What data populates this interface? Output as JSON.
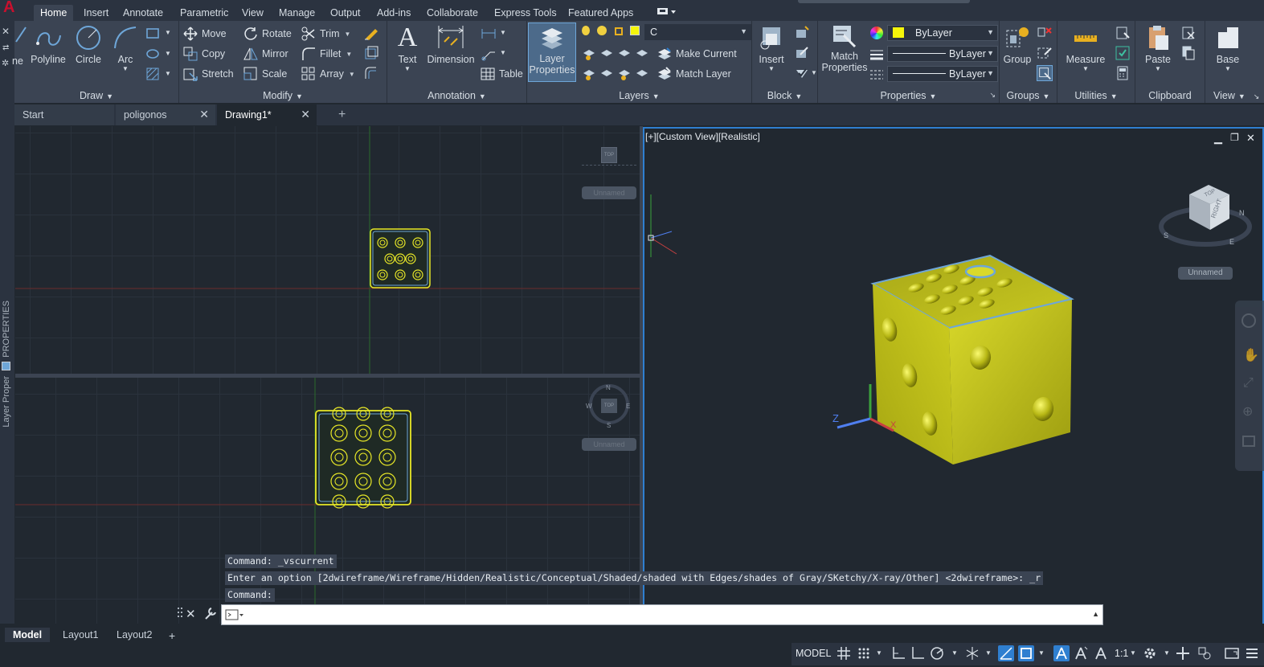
{
  "menubar": {
    "tabs": [
      "Home",
      "Insert",
      "Annotate",
      "Parametric",
      "View",
      "Manage",
      "Output",
      "Add-ins",
      "Collaborate",
      "Express Tools",
      "Featured Apps"
    ],
    "active": "Home"
  },
  "ribbon": {
    "draw": {
      "title": "Draw",
      "line_partial": "ne",
      "polyline": "Polyline",
      "circle": "Circle",
      "arc": "Arc"
    },
    "modify": {
      "title": "Modify",
      "move": "Move",
      "rotate": "Rotate",
      "trim": "Trim",
      "copy": "Copy",
      "mirror": "Mirror",
      "fillet": "Fillet",
      "stretch": "Stretch",
      "scale": "Scale",
      "array": "Array"
    },
    "annotation": {
      "title": "Annotation",
      "text": "Text",
      "dimension": "Dimension",
      "table": "Table"
    },
    "layers": {
      "title": "Layers",
      "layer_properties_line1": "Layer",
      "layer_properties_line2": "Properties",
      "current_layer": "C",
      "make_current": "Make Current",
      "match_layer": "Match Layer"
    },
    "block": {
      "title": "Block",
      "insert": "Insert"
    },
    "properties": {
      "title": "Properties",
      "match_line1": "Match",
      "match_line2": "Properties",
      "color": "ByLayer",
      "linetype": "ByLayer",
      "lineweight": "ByLayer"
    },
    "groups": {
      "title": "Groups",
      "group": "Group"
    },
    "utilities": {
      "title": "Utilities",
      "measure": "Measure"
    },
    "clipboard": {
      "title": "Clipboard",
      "paste": "Paste"
    },
    "view": {
      "title": "View",
      "base": "Base"
    }
  },
  "doctabs": {
    "tabs": [
      "Start",
      "poligonos",
      "Drawing1*"
    ],
    "active": "Drawing1*"
  },
  "leftstrip": {
    "properties": "PROPERTIES",
    "layer_properties": "Layer Proper"
  },
  "viewport3d": {
    "label": "[+][Custom View][Realistic]",
    "viewcube_top": "TOP",
    "viewcube_right": "RIGHT",
    "compass_n": "N",
    "compass_s": "S",
    "compass_e": "E",
    "ucs_name": "Unnamed"
  },
  "viewport_top": {
    "ucs_name": "Unnamed",
    "cube_face": "TOP"
  },
  "viewport_bottom": {
    "ucs_name": "Unnamed",
    "compass_n": "N",
    "compass_s": "S",
    "compass_e": "E",
    "compass_w": "W",
    "cube_face": "TOP"
  },
  "command": {
    "history": [
      "Command: _vscurrent",
      "Enter an option [2dwireframe/Wireframe/Hidden/Realistic/Conceptual/Shaded/shaded with Edges/shades of Gray/SKetchy/X-ray/Other] <2dwireframe>: _r",
      "Command:"
    ],
    "input_value": ""
  },
  "layouttabs": {
    "tabs": [
      "Model",
      "Layout1",
      "Layout2"
    ],
    "active": "Model"
  },
  "statusbar": {
    "model": "MODEL",
    "scale": "1:1"
  },
  "colors": {
    "accent": "#2f7fd0",
    "die_yellow": "#d6d61f",
    "outline_yellow": "#e8e827",
    "ribbon": "#3b4453"
  }
}
